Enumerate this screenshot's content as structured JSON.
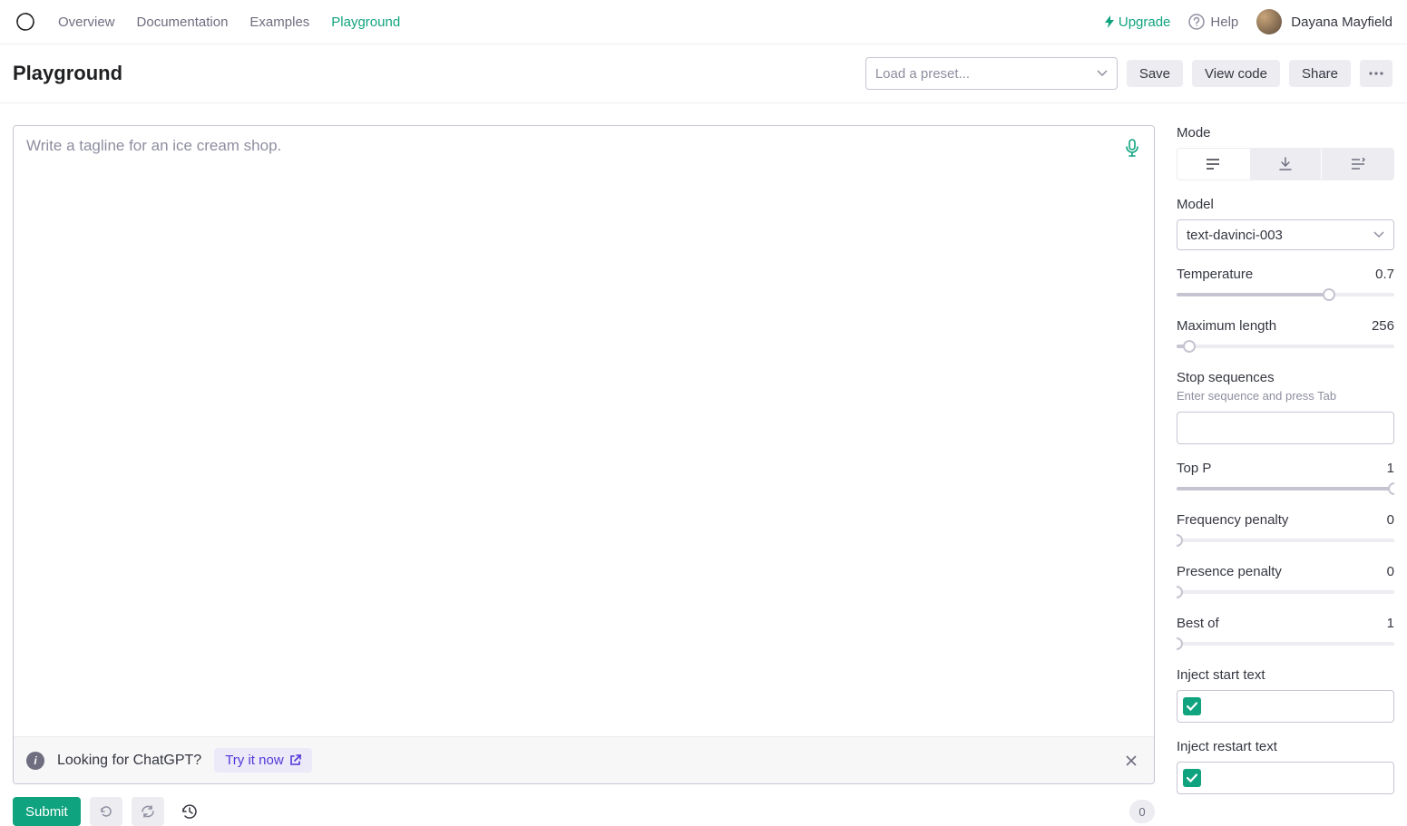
{
  "nav": {
    "links": [
      "Overview",
      "Documentation",
      "Examples",
      "Playground"
    ],
    "active_index": 3,
    "upgrade": "Upgrade",
    "help": "Help",
    "username": "Dayana Mayfield"
  },
  "header": {
    "title": "Playground",
    "preset_placeholder": "Load a preset...",
    "save": "Save",
    "view_code": "View code",
    "share": "Share"
  },
  "editor": {
    "placeholder": "Write a tagline for an ice cream shop.",
    "value": ""
  },
  "banner": {
    "text": "Looking for ChatGPT?",
    "action": "Try it now"
  },
  "footer": {
    "submit": "Submit",
    "token_count": "0"
  },
  "sidebar": {
    "mode_label": "Mode",
    "model_label": "Model",
    "model_value": "text-davinci-003",
    "params": {
      "temperature": {
        "label": "Temperature",
        "value": "0.7",
        "pct": 70
      },
      "maxlen": {
        "label": "Maximum length",
        "value": "256",
        "pct": 6
      },
      "topp": {
        "label": "Top P",
        "value": "1",
        "pct": 100
      },
      "freq": {
        "label": "Frequency penalty",
        "value": "0",
        "pct": 0
      },
      "pres": {
        "label": "Presence penalty",
        "value": "0",
        "pct": 0
      },
      "bestof": {
        "label": "Best of",
        "value": "1",
        "pct": 0
      }
    },
    "stop_label": "Stop sequences",
    "stop_hint": "Enter sequence and press Tab",
    "inject_start_label": "Inject start text",
    "inject_restart_label": "Inject restart text"
  }
}
